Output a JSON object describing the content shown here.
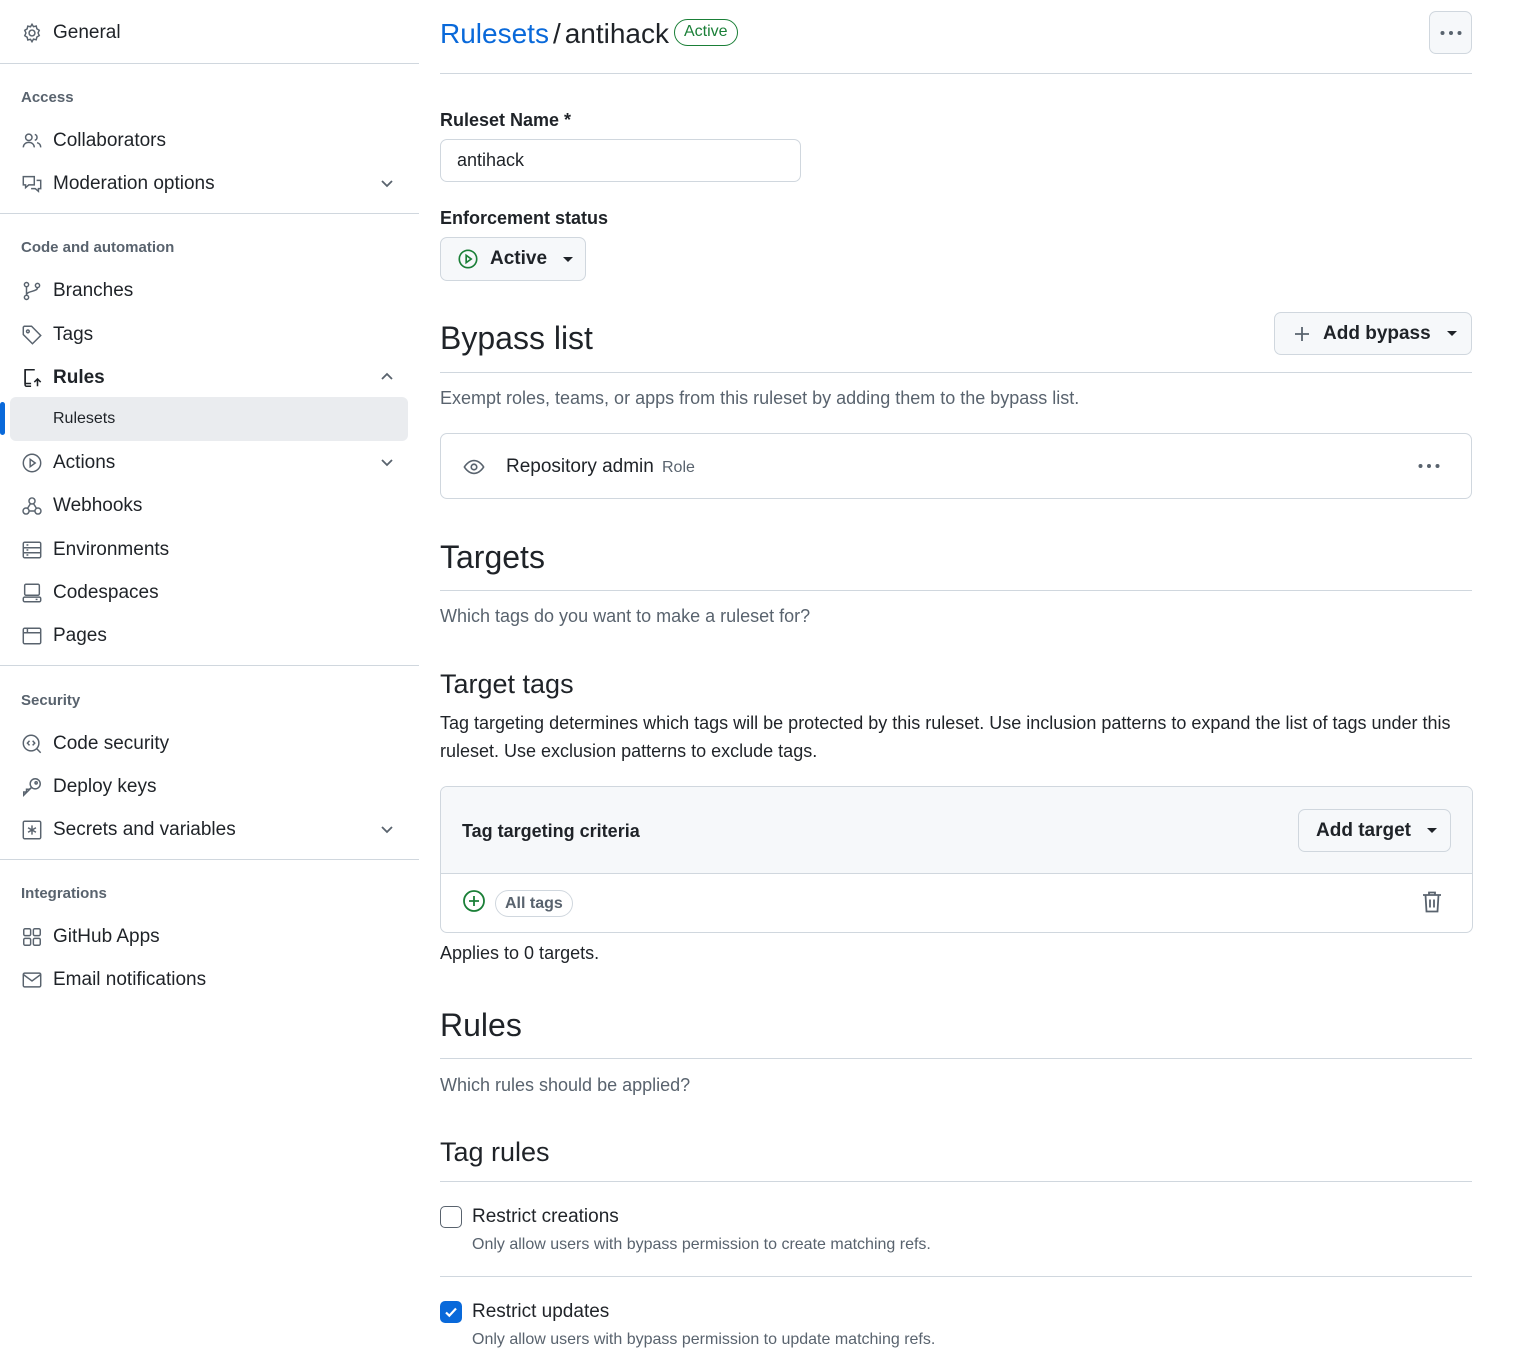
{
  "sidebar": {
    "general": "General",
    "sections": {
      "access": "Access",
      "code_automation": "Code and automation",
      "security": "Security",
      "integrations": "Integrations"
    },
    "items": {
      "collaborators": "Collaborators",
      "moderation": "Moderation options",
      "branches": "Branches",
      "tags": "Tags",
      "rules": "Rules",
      "rulesets": "Rulesets",
      "actions": "Actions",
      "webhooks": "Webhooks",
      "environments": "Environments",
      "codespaces": "Codespaces",
      "pages": "Pages",
      "code_security": "Code security",
      "deploy_keys": "Deploy keys",
      "secrets": "Secrets and variables",
      "github_apps": "GitHub Apps",
      "email_notifications": "Email notifications"
    },
    "active_item": "rulesets"
  },
  "header": {
    "breadcrumb_link": "Rulesets",
    "separator": "/",
    "ruleset": "antihack",
    "status_badge": "Active"
  },
  "form": {
    "name_label": "Ruleset Name *",
    "name_value": "antihack",
    "enforcement_label": "Enforcement status",
    "enforcement_value": "Active"
  },
  "bypass": {
    "title": "Bypass list",
    "add_button": "Add bypass",
    "description": "Exempt roles, teams, or apps from this ruleset by adding them to the bypass list.",
    "entries": [
      {
        "name": "Repository admin",
        "type": "Role"
      }
    ]
  },
  "targets": {
    "title": "Targets",
    "description": "Which tags do you want to make a ruleset for?",
    "subtitle": "Target tags",
    "body": "Tag targeting determines which tags will be protected by this ruleset. Use inclusion patterns to expand the list of tags under this ruleset. Use exclusion patterns to exclude tags.",
    "criteria_title": "Tag targeting criteria",
    "add_target": "Add target",
    "criteria": [
      "All tags"
    ],
    "applies": "Applies to 0 targets."
  },
  "rules": {
    "title": "Rules",
    "description": "Which rules should be applied?",
    "subtitle": "Tag rules",
    "items": [
      {
        "title": "Restrict creations",
        "desc": "Only allow users with bypass permission to create matching refs.",
        "checked": false
      },
      {
        "title": "Restrict updates",
        "desc": "Only allow users with bypass permission to update matching refs.",
        "checked": true
      }
    ]
  },
  "colors": {
    "accent": "#0969da",
    "success": "#1a7f37",
    "border": "#d0d7de",
    "muted": "#59636e",
    "active_bg": "#eaecef"
  },
  "icons": {
    "general": "gear-icon",
    "collaborators": "people-icon",
    "moderation": "comment-discussion-icon",
    "branches": "git-branch-icon",
    "tags": "tag-icon",
    "rules": "repo-push-icon",
    "actions": "play-icon",
    "webhooks": "webhook-icon",
    "environments": "server-icon",
    "codespaces": "codespaces-icon",
    "pages": "browser-icon",
    "code_security": "codescan-icon",
    "deploy_keys": "key-icon",
    "secrets": "key-asterisk-icon",
    "github_apps": "apps-icon",
    "email_notifications": "mail-icon"
  }
}
